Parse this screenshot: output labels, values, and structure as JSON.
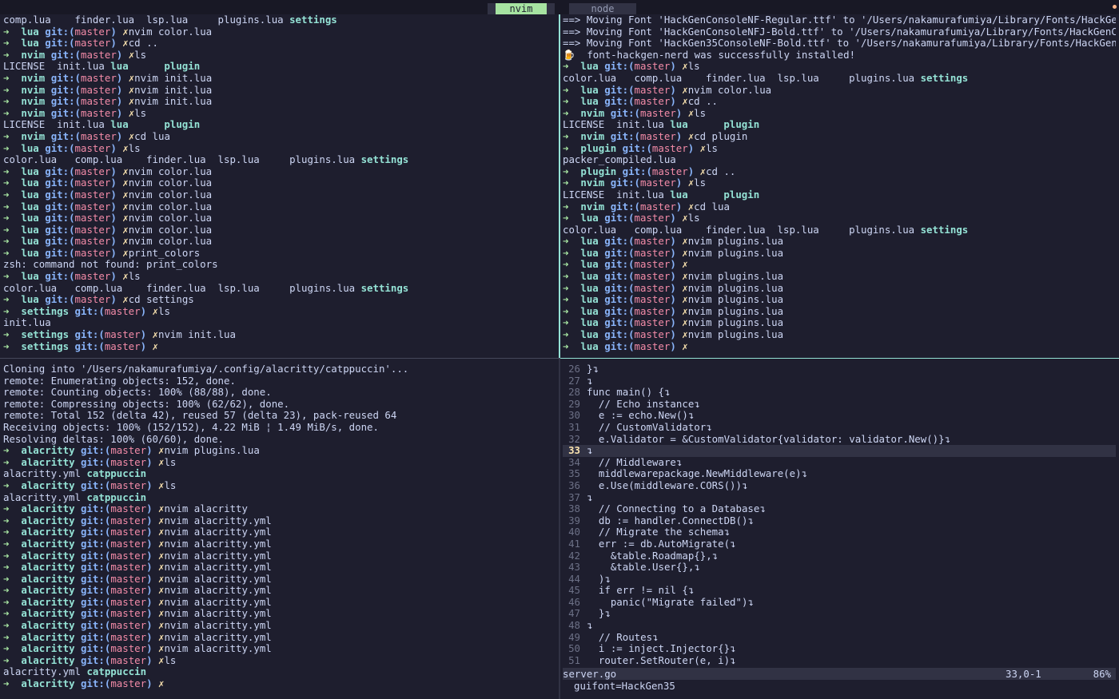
{
  "tabs": [
    {
      "label": "nvim",
      "active": true
    },
    {
      "label": "node",
      "active": false
    }
  ],
  "colors": {
    "accent": "#94e2d5",
    "prompt_arrow": "#a6e3a1",
    "git": "#89b4fa",
    "branch": "#f38ba8",
    "dirty": "#f9e2af",
    "bg": "#1e1e2e"
  },
  "pane_top_left": [
    {
      "out": "comp.lua    finder.lua  lsp.lua     plugins.lua ",
      "bold": "settings"
    },
    {
      "dir": "lua",
      "cmd": "nvim color.lua"
    },
    {
      "dir": "lua",
      "cmd": "cd .."
    },
    {
      "dir": "nvim",
      "cmd": "ls"
    },
    {
      "out": "LICENSE  init.lua ",
      "bold": "lua      plugin"
    },
    {
      "dir": "nvim",
      "cmd": "nvim init.lua"
    },
    {
      "dir": "nvim",
      "cmd": "nvim init.lua"
    },
    {
      "dir": "nvim",
      "cmd": "nvim init.lua"
    },
    {
      "dir": "nvim",
      "cmd": "ls"
    },
    {
      "out": "LICENSE  init.lua ",
      "bold": "lua      plugin"
    },
    {
      "dir": "nvim",
      "cmd": "cd lua"
    },
    {
      "dir": "lua",
      "cmd": "ls"
    },
    {
      "out": "color.lua   comp.lua    finder.lua  lsp.lua     plugins.lua ",
      "bold": "settings"
    },
    {
      "dir": "lua",
      "cmd": "nvim color.lua"
    },
    {
      "dir": "lua",
      "cmd": "nvim color.lua"
    },
    {
      "dir": "lua",
      "cmd": "nvim color.lua"
    },
    {
      "dir": "lua",
      "cmd": "nvim color.lua"
    },
    {
      "dir": "lua",
      "cmd": "nvim color.lua"
    },
    {
      "dir": "lua",
      "cmd": "nvim color.lua"
    },
    {
      "dir": "lua",
      "cmd": "nvim color.lua"
    },
    {
      "dir": "lua",
      "cmd": "print_colors"
    },
    {
      "out": "zsh: command not found: print_colors",
      "bold": ""
    },
    {
      "dir": "lua",
      "cmd": "ls"
    },
    {
      "out": "color.lua   comp.lua    finder.lua  lsp.lua     plugins.lua ",
      "bold": "settings"
    },
    {
      "dir": "lua",
      "cmd": "cd settings"
    },
    {
      "dir": "settings",
      "cmd": "ls"
    },
    {
      "out": "init.lua",
      "bold": ""
    },
    {
      "dir": "settings",
      "cmd": "nvim init.lua"
    },
    {
      "dir": "settings",
      "cmd": ""
    }
  ],
  "pane_top_right": [
    {
      "out": "==> Moving Font 'HackGenConsoleNF-Regular.ttf' to '/Users/nakamurafumiya/Library/Fonts/HackGen",
      "bold": ""
    },
    {
      "out": "==> Moving Font 'HackGenConsoleNFJ-Bold.ttf' to '/Users/nakamurafumiya/Library/Fonts/HackGenCo",
      "bold": ""
    },
    {
      "out": "==> Moving Font 'HackGen35ConsoleNF-Bold.ttf' to '/Users/nakamurafumiya/Library/Fonts/HackGen3",
      "bold": ""
    },
    {
      "out": "🍺  font-hackgen-nerd was successfully installed!",
      "bold": ""
    },
    {
      "dir": "lua",
      "cmd": "ls"
    },
    {
      "out": "color.lua   comp.lua    finder.lua  lsp.lua     plugins.lua ",
      "bold": "settings"
    },
    {
      "dir": "lua",
      "cmd": "nvim color.lua"
    },
    {
      "dir": "lua",
      "cmd": "cd .."
    },
    {
      "dir": "nvim",
      "cmd": "ls"
    },
    {
      "out": "LICENSE  init.lua ",
      "bold": "lua      plugin"
    },
    {
      "dir": "nvim",
      "cmd": "cd plugin"
    },
    {
      "dir": "plugin",
      "cmd": "ls"
    },
    {
      "out": "packer_compiled.lua",
      "bold": ""
    },
    {
      "dir": "plugin",
      "cmd": "cd .."
    },
    {
      "dir": "nvim",
      "cmd": "ls"
    },
    {
      "out": "LICENSE  init.lua ",
      "bold": "lua      plugin"
    },
    {
      "dir": "nvim",
      "cmd": "cd lua"
    },
    {
      "dir": "lua",
      "cmd": "ls"
    },
    {
      "out": "color.lua   comp.lua    finder.lua  lsp.lua     plugins.lua ",
      "bold": "settings"
    },
    {
      "dir": "lua",
      "cmd": "nvim plugins.lua"
    },
    {
      "dir": "lua",
      "cmd": "nvim plugins.lua"
    },
    {
      "dir": "lua",
      "cmd": ""
    },
    {
      "dir": "lua",
      "cmd": "nvim plugins.lua"
    },
    {
      "dir": "lua",
      "cmd": "nvim plugins.lua"
    },
    {
      "dir": "lua",
      "cmd": "nvim plugins.lua"
    },
    {
      "dir": "lua",
      "cmd": "nvim plugins.lua"
    },
    {
      "dir": "lua",
      "cmd": "nvim plugins.lua"
    },
    {
      "dir": "lua",
      "cmd": "nvim plugins.lua"
    },
    {
      "dir": "lua",
      "cmd": ""
    }
  ],
  "pane_bottom_left": [
    {
      "out": "Cloning into '/Users/nakamurafumiya/.config/alacritty/catppuccin'...",
      "bold": ""
    },
    {
      "out": "remote: Enumerating objects: 152, done.",
      "bold": ""
    },
    {
      "out": "remote: Counting objects: 100% (88/88), done.",
      "bold": ""
    },
    {
      "out": "remote: Compressing objects: 100% (62/62), done.",
      "bold": ""
    },
    {
      "out": "remote: Total 152 (delta 42), reused 57 (delta 23), pack-reused 64",
      "bold": ""
    },
    {
      "out": "Receiving objects: 100% (152/152), 4.22 MiB ¦ 1.49 MiB/s, done.",
      "bold": ""
    },
    {
      "out": "Resolving deltas: 100% (60/60), done.",
      "bold": ""
    },
    {
      "dir": "alacritty",
      "cmd": "nvim plugins.lua"
    },
    {
      "dir": "alacritty",
      "cmd": "ls"
    },
    {
      "out": "alacritty.yml ",
      "bold": "catppuccin"
    },
    {
      "dir": "alacritty",
      "cmd": "ls"
    },
    {
      "out": "alacritty.yml ",
      "bold": "catppuccin"
    },
    {
      "dir": "alacritty",
      "cmd": "nvim alacritty"
    },
    {
      "dir": "alacritty",
      "cmd": "nvim alacritty.yml"
    },
    {
      "dir": "alacritty",
      "cmd": "nvim alacritty.yml"
    },
    {
      "dir": "alacritty",
      "cmd": "nvim alacritty.yml"
    },
    {
      "dir": "alacritty",
      "cmd": "nvim alacritty.yml"
    },
    {
      "dir": "alacritty",
      "cmd": "nvim alacritty.yml"
    },
    {
      "dir": "alacritty",
      "cmd": "nvim alacritty.yml"
    },
    {
      "dir": "alacritty",
      "cmd": "nvim alacritty.yml"
    },
    {
      "dir": "alacritty",
      "cmd": "nvim alacritty.yml"
    },
    {
      "dir": "alacritty",
      "cmd": "nvim alacritty.yml"
    },
    {
      "dir": "alacritty",
      "cmd": "nvim alacritty.yml"
    },
    {
      "dir": "alacritty",
      "cmd": "nvim alacritty.yml"
    },
    {
      "dir": "alacritty",
      "cmd": "nvim alacritty.yml"
    },
    {
      "dir": "alacritty",
      "cmd": "ls"
    },
    {
      "out": "alacritty.yml ",
      "bold": "catppuccin"
    },
    {
      "dir": "alacritty",
      "cmd": ""
    }
  ],
  "editor": {
    "lines": [
      {
        "n": "26",
        "code": "}↴"
      },
      {
        "n": "27",
        "code": "↴"
      },
      {
        "n": "28",
        "code": "func main() {↴"
      },
      {
        "n": "29",
        "code": "  // Echo instance↴"
      },
      {
        "n": "30",
        "code": "  e := echo.New()↴"
      },
      {
        "n": "31",
        "code": "  // CustomValidator↴"
      },
      {
        "n": "32",
        "code": "  e.Validator = &CustomValidator{validator: validator.New()}↴"
      },
      {
        "n": "33",
        "code": "↴",
        "cur": true
      },
      {
        "n": "34",
        "code": "  // Middleware↴"
      },
      {
        "n": "35",
        "code": "  middlewarepackage.NewMiddleware(e)↴"
      },
      {
        "n": "36",
        "code": "  e.Use(middleware.CORS())↴"
      },
      {
        "n": "37",
        "code": "↴"
      },
      {
        "n": "38",
        "code": "  // Connecting to a Database↴"
      },
      {
        "n": "39",
        "code": "  db := handler.ConnectDB()↴"
      },
      {
        "n": "40",
        "code": "  // Migrate the schema↴"
      },
      {
        "n": "41",
        "code": "  err := db.AutoMigrate(↴"
      },
      {
        "n": "42",
        "code": "    &table.Roadmap{},↴"
      },
      {
        "n": "43",
        "code": "    &table.User{},↴"
      },
      {
        "n": "44",
        "code": "  )↴"
      },
      {
        "n": "45",
        "code": "  if err != nil {↴"
      },
      {
        "n": "46",
        "code": "    panic(\"Migrate failed\")↴"
      },
      {
        "n": "47",
        "code": "  }↴"
      },
      {
        "n": "48",
        "code": "↴"
      },
      {
        "n": "49",
        "code": "  // Routes↴"
      },
      {
        "n": "50",
        "code": "  i := inject.Injector{}↴"
      },
      {
        "n": "51",
        "code": "  router.SetRouter(e, i)↴"
      }
    ],
    "status": {
      "filename": "server.go",
      "position": "33,0-1",
      "percent": "86%"
    },
    "cmdline": "guifont=HackGen35"
  },
  "git_label": "git:(",
  "branch_name": "master",
  "git_close": ")",
  "dirty_mark": "✗",
  "prompt_arrow": "➜"
}
